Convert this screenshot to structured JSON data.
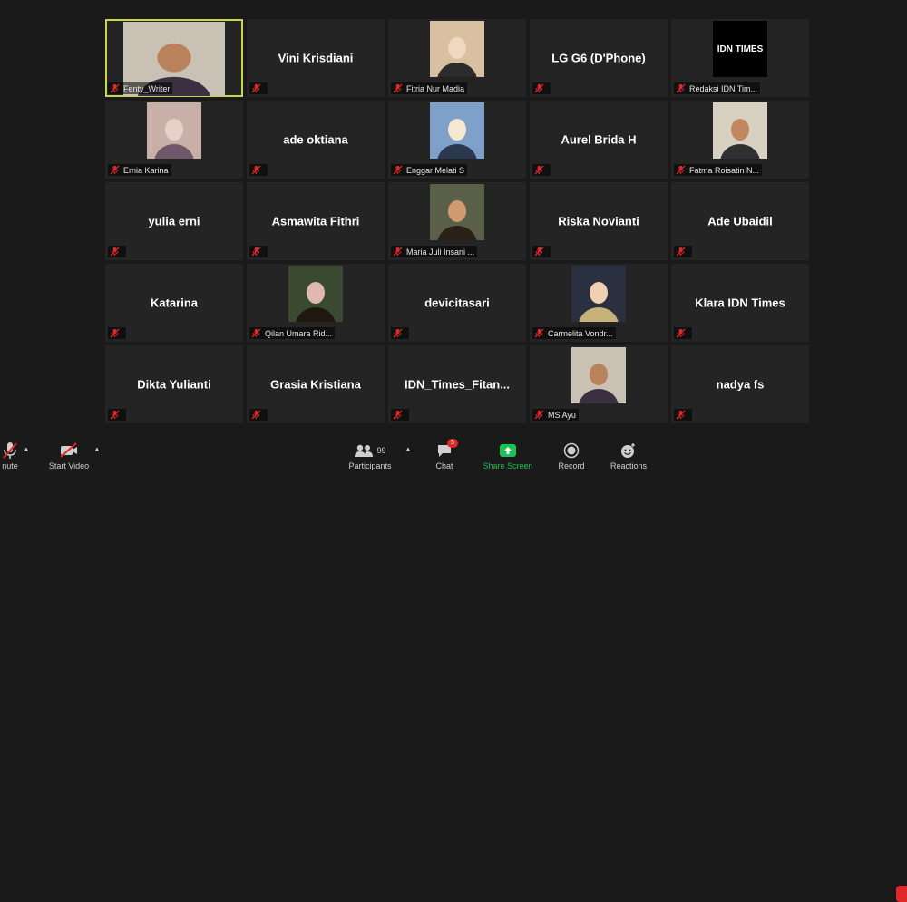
{
  "participants": [
    {
      "name": "Fenty_Writer",
      "video": true,
      "speaking": true
    },
    {
      "name": "Vini Krisdiani",
      "video": false
    },
    {
      "name": "Fitria Nur Madia",
      "video": true
    },
    {
      "name": "LG G6 (D'Phone)",
      "video": false
    },
    {
      "name": "Redaksi IDN Tim...",
      "video": true,
      "logo_text": "IDN TIMES"
    },
    {
      "name": "Ernia Karina",
      "video": true
    },
    {
      "name": "ade oktiana",
      "video": false
    },
    {
      "name": "Enggar Melati S",
      "video": true
    },
    {
      "name": "Aurel Brida H",
      "video": false
    },
    {
      "name": "Fatma Roisatin N...",
      "video": true
    },
    {
      "name": "yulia erni",
      "video": false
    },
    {
      "name": "Asmawita Fithri",
      "video": false
    },
    {
      "name": "Maria Juli Insani ...",
      "video": true
    },
    {
      "name": "Riska Novianti",
      "video": false
    },
    {
      "name": "Ade Ubaidil",
      "video": false
    },
    {
      "name": "Katarina",
      "video": false
    },
    {
      "name": "Qilan Umara Rid...",
      "video": true
    },
    {
      "name": "devicitasari",
      "video": false
    },
    {
      "name": "Carmelita Vondr...",
      "video": true
    },
    {
      "name": "Klara IDN Times",
      "video": false
    },
    {
      "name": "Dikta Yulianti",
      "video": false
    },
    {
      "name": "Grasia Kristiana",
      "video": false
    },
    {
      "name": "IDN_Times_Fitan...",
      "video": false
    },
    {
      "name": "MS Ayu",
      "video": true
    },
    {
      "name": "nadya fs",
      "video": false
    }
  ],
  "toolbar": {
    "unmute_label": "nute",
    "start_video_label": "Start Video",
    "participants_label": "Participants",
    "participants_count": "99",
    "chat_label": "Chat",
    "chat_badge": "5",
    "share_screen_label": "Share Screen",
    "record_label": "Record",
    "reactions_label": "Reactions"
  },
  "colors": {
    "background": "#1a1a1a",
    "tile": "#242424",
    "active_speaker": "#c8d64a",
    "share_green": "#1fbf5a",
    "mic_off_red": "#e02828"
  }
}
